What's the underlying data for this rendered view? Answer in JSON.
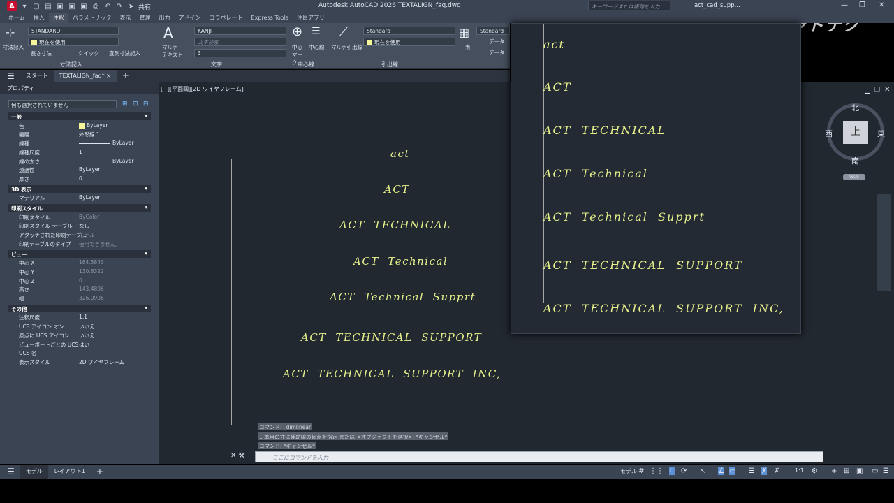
{
  "titlebar": {
    "share_label": "共有",
    "title": "Autodesk AutoCAD 2026    TEXTALIGN_faq.dwg",
    "search_placeholder": "キーワードまたは語句を入力",
    "user": "act_cad_supp...",
    "brand_logo": "キャドテク"
  },
  "ribbon_tabs": [
    "ホーム",
    "挿入",
    "注釈",
    "パラメトリック",
    "表示",
    "管理",
    "出力",
    "アドイン",
    "コラボレート",
    "Express Tools",
    "注目アプリ"
  ],
  "ribbon_active_tab": "注釈",
  "ribbon": {
    "dim_style": "STANDARD",
    "dim_layer": "現在を使用",
    "dim_label": "寸法記入",
    "dim_linear": "長さ寸法",
    "dim_quick": "クイック",
    "dim_continue": "直列寸法記入",
    "dim_group": "寸法記入",
    "mtext_label": "マルチ テキスト",
    "text_style": "KANJI",
    "text_search": "文字検索",
    "text_height": "3",
    "text_group": "文字",
    "center_mark": "中心 マーク",
    "centerline": "中心線",
    "center_group": "中心線",
    "mleader_label": "マルチ引出線",
    "mleader_style": "Standard",
    "mleader_layer": "現在を使用",
    "mleader_group": "引出線",
    "table_label": "表",
    "table_style": "Standard",
    "table_data1": "データ",
    "table_data2": "データ"
  },
  "doctabs": {
    "start": "スタート",
    "file": "TEXTALIGN_faq*",
    "close": "×",
    "add": "+"
  },
  "properties": {
    "title": "プロパティ",
    "selection": "何も選択されていません",
    "sections": [
      {
        "name": "一般",
        "rows": [
          {
            "k": "色",
            "v": "ByLayer",
            "swatch": true
          },
          {
            "k": "画層",
            "v": "外形線 1"
          },
          {
            "k": "線種",
            "v": "ByLayer",
            "line": true
          },
          {
            "k": "線種尺度",
            "v": "1"
          },
          {
            "k": "線の太さ",
            "v": "ByLayer",
            "line": true
          },
          {
            "k": "透過性",
            "v": "ByLayer"
          },
          {
            "k": "厚さ",
            "v": "0"
          }
        ]
      },
      {
        "name": "3D 表示",
        "rows": [
          {
            "k": "マテリアル",
            "v": "ByLayer"
          }
        ]
      },
      {
        "name": "印刷スタイル",
        "rows": [
          {
            "k": "印刷スタイル",
            "v": "ByColor",
            "dim": true
          },
          {
            "k": "印刷スタイル テーブル",
            "v": "なし"
          },
          {
            "k": "アタッチされた印刷テーブ...",
            "v": "モデル",
            "dim": true
          },
          {
            "k": "印刷テーブルのタイプ",
            "v": "使用できません。",
            "dim": true
          }
        ]
      },
      {
        "name": "ビュー",
        "rows": [
          {
            "k": "中心 X",
            "v": "164.5843",
            "dim": true
          },
          {
            "k": "中心 Y",
            "v": "130.8322",
            "dim": true
          },
          {
            "k": "中心 Z",
            "v": "0",
            "dim": true
          },
          {
            "k": "高さ",
            "v": "143.4896",
            "dim": true
          },
          {
            "k": "幅",
            "v": "326.0906",
            "dim": true
          }
        ]
      },
      {
        "name": "その他",
        "rows": [
          {
            "k": "注釈尺度",
            "v": "1:1"
          },
          {
            "k": "UCS アイコン オン",
            "v": "いいえ"
          },
          {
            "k": "原点に UCS アイコン",
            "v": "いいえ"
          },
          {
            "k": "ビューポートごとの UCS",
            "v": "はい"
          },
          {
            "k": "UCS 名",
            "v": ""
          },
          {
            "k": "表示スタイル",
            "v": "2D ワイヤフレーム"
          }
        ]
      }
    ]
  },
  "drawing": {
    "viewport_label": "[−][平面図][2D ワイヤフレーム]",
    "texts": [
      "act",
      "ACT",
      "ACT  TECHNICAL",
      "ACT  Technical",
      "ACT  Technical  Supprt",
      "ACT  TECHNICAL  SUPPORT",
      "ACT  TECHNICAL  SUPPORT  INC,"
    ]
  },
  "zoom_panel": {
    "texts": [
      "act",
      "ACT",
      "ACT  TECHNICAL",
      "ACT  Technical",
      "ACT  Technical  Supprt",
      "ACT  TECHNICAL  SUPPORT",
      "ACT  TECHNICAL  SUPPORT  INC,"
    ]
  },
  "viewcube": {
    "north": "北",
    "south": "南",
    "east": "東",
    "west": "西",
    "top": "上",
    "ucs": "WCS"
  },
  "command": {
    "history": [
      "コマンド: _dimlinear",
      "1 本目の寸法補助線の起点を指定 または <オブジェクトを選択>: *キャンセル*",
      "コマンド: *キャンセル*"
    ],
    "placeholder": "ここにコマンドを入力"
  },
  "statusbar": {
    "model": "モデル",
    "layout1": "レイアウト1",
    "add": "+",
    "model_right": "モデル",
    "scale": "1:1"
  }
}
